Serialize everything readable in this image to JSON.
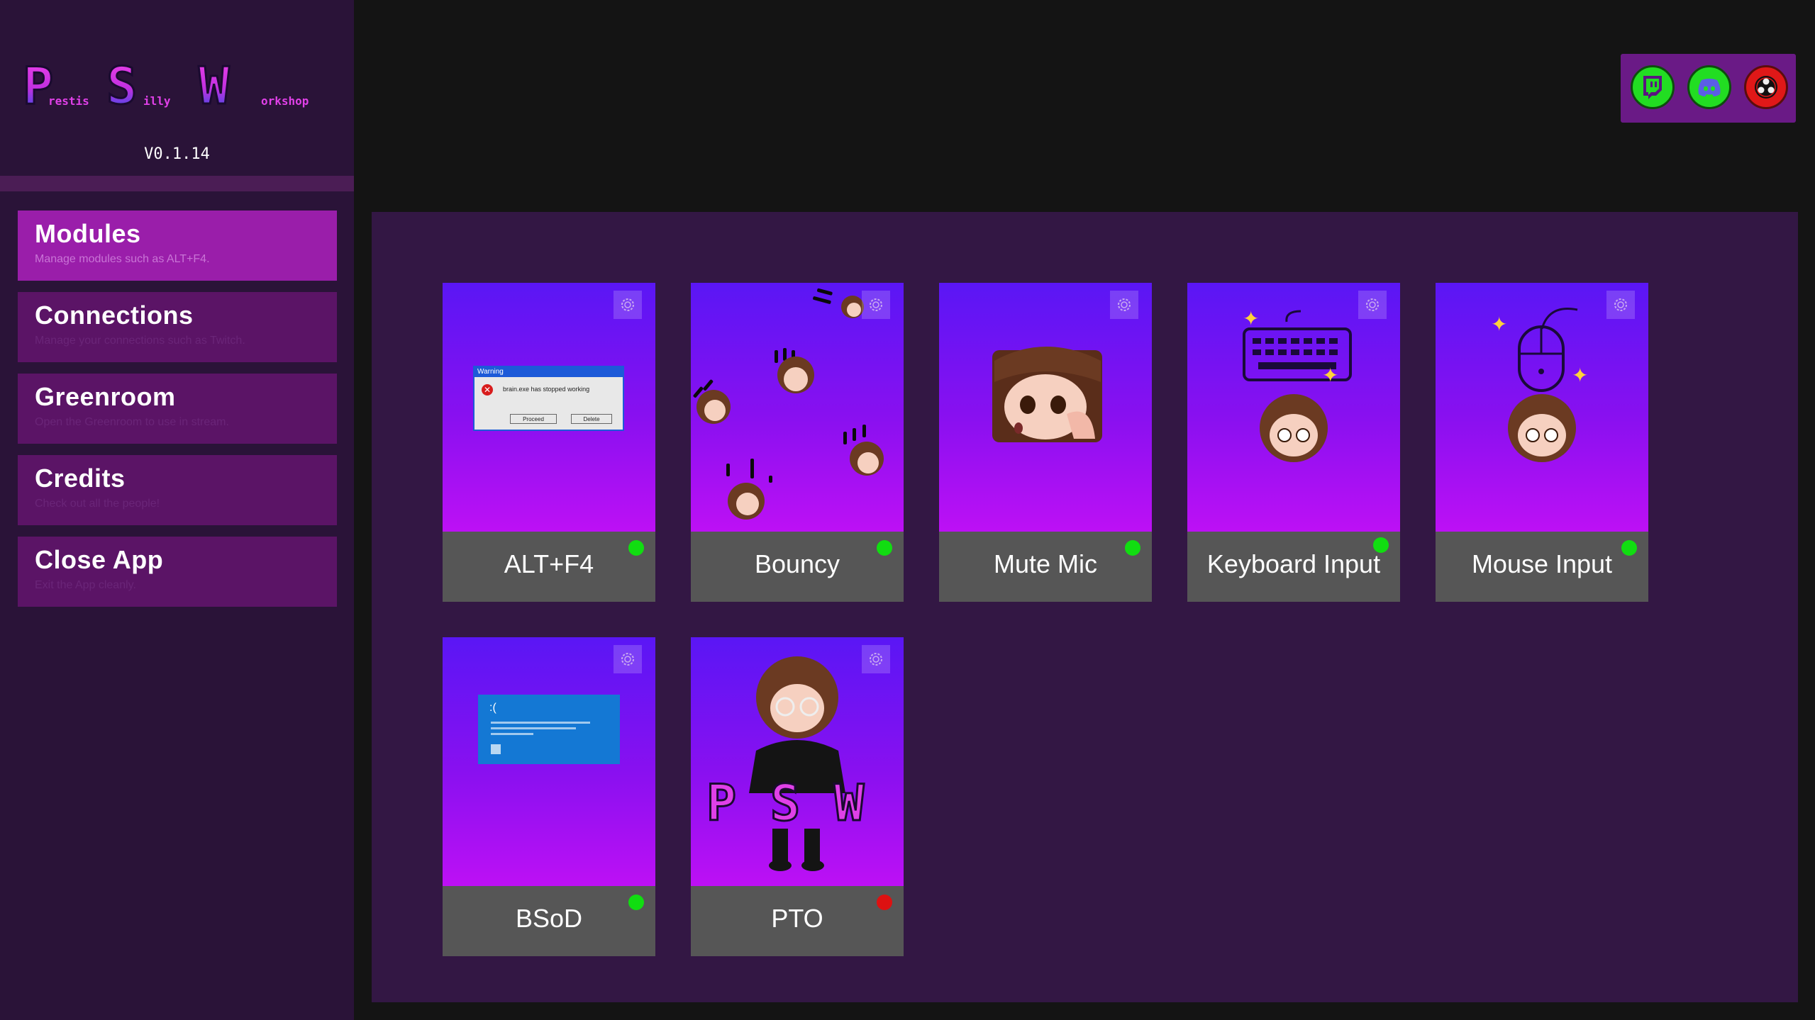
{
  "app": {
    "logo_letters": [
      "P",
      "S",
      "W"
    ],
    "logo_small": [
      "restis",
      "illy",
      "orkshop"
    ],
    "version": "V0.1.14"
  },
  "sidebar": {
    "items": [
      {
        "title": "Modules",
        "desc": "Manage modules such as ALT+F4.",
        "active": true
      },
      {
        "title": "Connections",
        "desc": "Manage your connections such as Twitch.",
        "active": false
      },
      {
        "title": "Greenroom",
        "desc": "Open the Greenroom to use in stream.",
        "active": false
      },
      {
        "title": "Credits",
        "desc": "Check out all the people!",
        "active": false
      },
      {
        "title": "Close App",
        "desc": "Exit the App cleanly.",
        "active": false
      }
    ]
  },
  "social": [
    {
      "name": "twitch-icon",
      "color": "#22dd22"
    },
    {
      "name": "discord-icon",
      "color": "#22dd22"
    },
    {
      "name": "obs-icon",
      "color": "#e01818"
    }
  ],
  "modules": [
    {
      "name": "ALT+F4",
      "status": "on",
      "art": "dialog",
      "dialog": {
        "title": "Warning",
        "message": "brain.exe has stopped working",
        "proceed": "Proceed",
        "delete": "Delete"
      }
    },
    {
      "name": "Bouncy",
      "status": "on",
      "art": "bouncy"
    },
    {
      "name": "Mute Mic",
      "status": "on",
      "art": "face"
    },
    {
      "name": "Keyboard Input",
      "status": "on",
      "art": "keyboard"
    },
    {
      "name": "Mouse Input",
      "status": "on",
      "art": "mouse"
    },
    {
      "name": "BSoD",
      "status": "on",
      "art": "bsod",
      "bsod": {
        "face": ":("
      }
    },
    {
      "name": "PTO",
      "status": "off",
      "art": "pto"
    }
  ],
  "colors": {
    "status_on": "#11dd11",
    "status_off": "#dd1111",
    "accent": "#9a1eaa",
    "logo_pink": "#e040e8",
    "logo_blue": "#2050e8"
  }
}
